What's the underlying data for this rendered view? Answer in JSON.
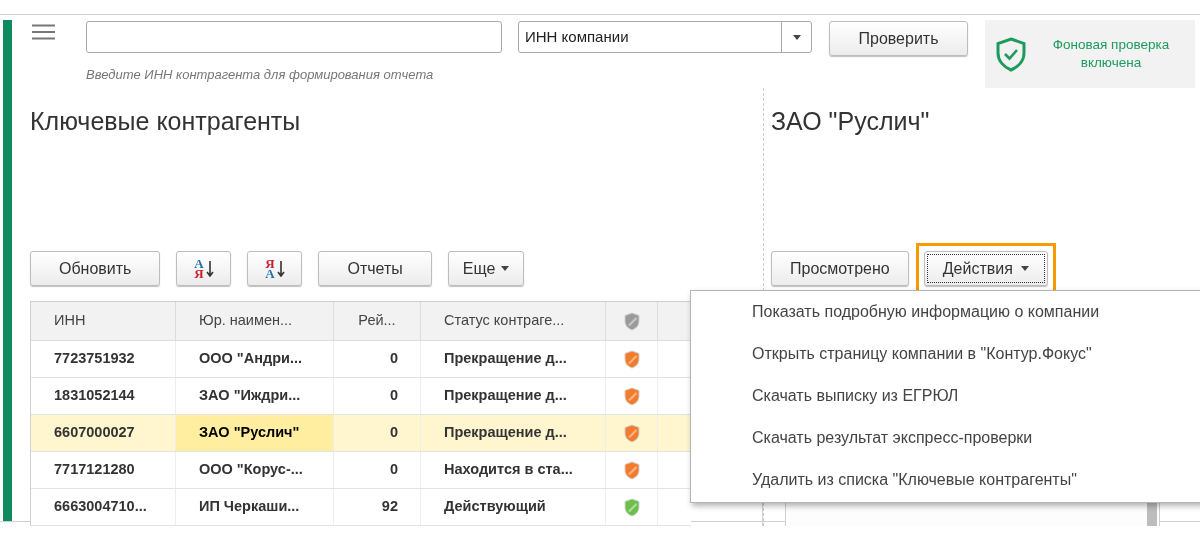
{
  "top_bar": {
    "search": {
      "hint": "Введите ИНН контрагента для формирования отчета"
    },
    "search_type": {
      "value": "ИНН компании"
    },
    "check_button": "Проверить",
    "background_check": {
      "on": true,
      "label": "Фоновая проверка включена"
    }
  },
  "key_counterparties": {
    "title": "Ключевые контрагенты",
    "toolbar": [
      {
        "kind": "button",
        "label": "Обновить"
      },
      {
        "kind": "sort",
        "letters": [
          "А",
          "Я"
        ]
      },
      {
        "kind": "sort",
        "letters": [
          "Я",
          "А"
        ]
      },
      {
        "kind": "button",
        "label": "Отчеты"
      },
      {
        "kind": "menu",
        "label": "Еще"
      }
    ],
    "table": {
      "columns": [
        "ИНН",
        "Юр. наимен...",
        "Рей...",
        "Статус контраге..."
      ],
      "rows": [
        {
          "inn": "7723751932",
          "name": "ООО \"Андри...",
          "rating": "0",
          "status": "Прекращение д...",
          "color": "#f47b2a",
          "selected": false
        },
        {
          "inn": "1831052144",
          "name": "ЗАО \"Иждри...",
          "rating": "0",
          "status": "Прекращение д...",
          "color": "#f47b2a",
          "selected": false
        },
        {
          "inn": "6607000027",
          "name": "ЗАО \"Руслич\"",
          "rating": "0",
          "status": "Прекращение д...",
          "color": "#f47b2a",
          "selected": true
        },
        {
          "inn": "7717121280",
          "name": "ООО \"Корус-...",
          "rating": "0",
          "status": "Находится в ста...",
          "color": "#f47b2a",
          "selected": false
        },
        {
          "inn": "6663004710...",
          "name": "ИП Черкаши...",
          "rating": "92",
          "status": "Действующий",
          "color": "#6cc04a",
          "selected": false
        }
      ]
    }
  },
  "company": {
    "title": "ЗАО \"Руслич\"",
    "buttons": [
      {
        "label": "Просмотрено",
        "focused": false
      },
      {
        "label": "Действия",
        "focused": true
      }
    ],
    "actions_menu": [
      "Показать подробную информацию о компании",
      "Открыть страницу компании в \"Контур.Фокус\"",
      "Скачать выписку из ЕГРЮЛ",
      "Скачать результат экспресс-проверки",
      "Удалить из списка \"Ключевые контрагенты\""
    ]
  }
}
